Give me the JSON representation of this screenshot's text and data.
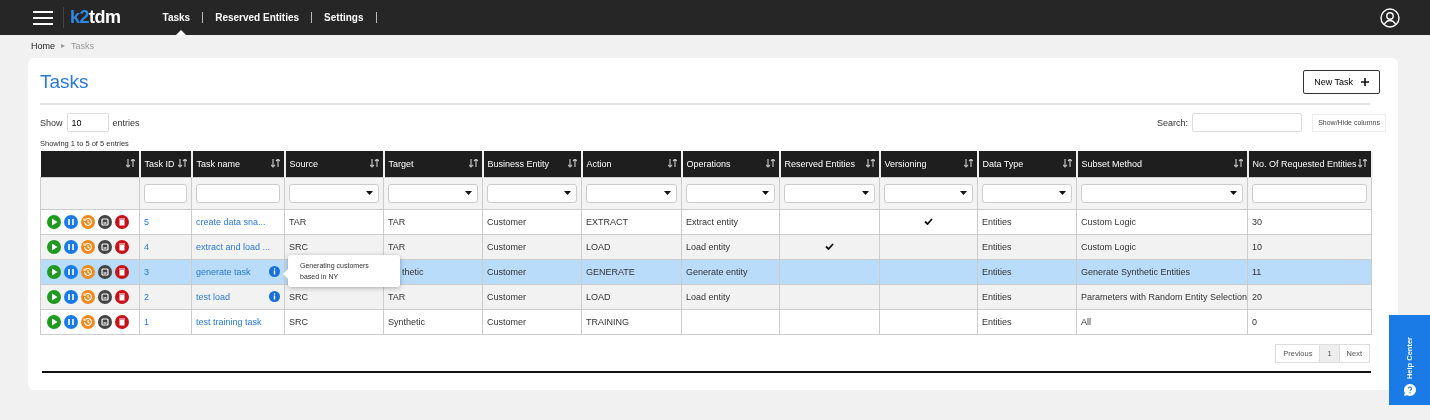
{
  "navbar": {
    "logo": {
      "brand": "k2",
      "product": "tdm"
    },
    "items": [
      {
        "label": "Tasks",
        "selected": true
      },
      {
        "label": "Reserved Entities",
        "selected": false
      },
      {
        "label": "Settings",
        "selected": false
      }
    ]
  },
  "breadcrumb": [
    {
      "label": "Home",
      "current": false
    },
    {
      "label": "Tasks",
      "current": true
    }
  ],
  "page_title": "Tasks",
  "new_task_button": "New Task",
  "length_control": {
    "before": "Show",
    "value": "10",
    "after": "entries"
  },
  "search": {
    "label": "Search:"
  },
  "show_hide_button": "Show/Hide columns",
  "info_text": "Showing 1 to 5 of 5 entries",
  "table": {
    "columns": [
      {
        "kind": "actions"
      },
      {
        "label": "Task ID",
        "kind": "textfilter"
      },
      {
        "label": "Task name",
        "kind": "textfilter"
      },
      {
        "label": "Source",
        "kind": "selectfilter"
      },
      {
        "label": "Target",
        "kind": "selectfilter"
      },
      {
        "label": "Business Entity",
        "kind": "selectfilter"
      },
      {
        "label": "Action",
        "kind": "selectfilter"
      },
      {
        "label": "Operations",
        "kind": "selectfilter"
      },
      {
        "label": "Reserved Entities",
        "kind": "selectfilter"
      },
      {
        "label": "Versioning",
        "kind": "selectfilter"
      },
      {
        "label": "Data Type",
        "kind": "selectfilter"
      },
      {
        "label": "Subset Method",
        "kind": "selectfilter"
      },
      {
        "label": "No. Of Requested Entities",
        "kind": "textfilter"
      }
    ],
    "rows": [
      {
        "selected": false,
        "id": "5",
        "name": "create data sna...",
        "info": false,
        "source": "TAR",
        "target": "TAR",
        "entity": "Customer",
        "action": "EXTRACT",
        "operations": "Extract entity",
        "reserved": false,
        "versioning": true,
        "data_type": "Entities",
        "subset": "Custom Logic",
        "requested": "30"
      },
      {
        "selected": false,
        "id": "4",
        "name": "extract and load ...",
        "info": false,
        "source": "SRC",
        "target": "TAR",
        "entity": "Customer",
        "action": "LOAD",
        "operations": "Load entity",
        "reserved": true,
        "versioning": false,
        "data_type": "Entities",
        "subset": "Custom Logic",
        "requested": "10"
      },
      {
        "selected": true,
        "id": "3",
        "name": "generate task",
        "info": true,
        "tooltip": "Generating customers based in NY",
        "target": "thetic",
        "entity": "Customer",
        "action": "GENERATE",
        "operations": "Generate entity",
        "reserved": false,
        "versioning": false,
        "data_type": "Entities",
        "subset": "Generate Synthetic Entities",
        "requested": "11"
      },
      {
        "selected": false,
        "id": "2",
        "name": "test load",
        "info": true,
        "source": "SRC",
        "target": "TAR",
        "entity": "Customer",
        "action": "LOAD",
        "operations": "Load entity",
        "reserved": false,
        "versioning": false,
        "data_type": "Entities",
        "subset": "Parameters with Random Entity Selection",
        "requested": "20"
      },
      {
        "selected": false,
        "id": "1",
        "name": "test training task",
        "info": false,
        "source": "SRC",
        "target": "Synthetic",
        "entity": "Customer",
        "action": "TRAINING",
        "reserved": false,
        "versioning": false,
        "data_type": "Entities",
        "subset": "All",
        "requested": "0"
      }
    ]
  },
  "pagination": [
    {
      "label": "Previous",
      "selected": false
    },
    {
      "label": "1",
      "selected": true
    },
    {
      "label": "Next",
      "selected": false
    }
  ],
  "help_center": "Help Center"
}
